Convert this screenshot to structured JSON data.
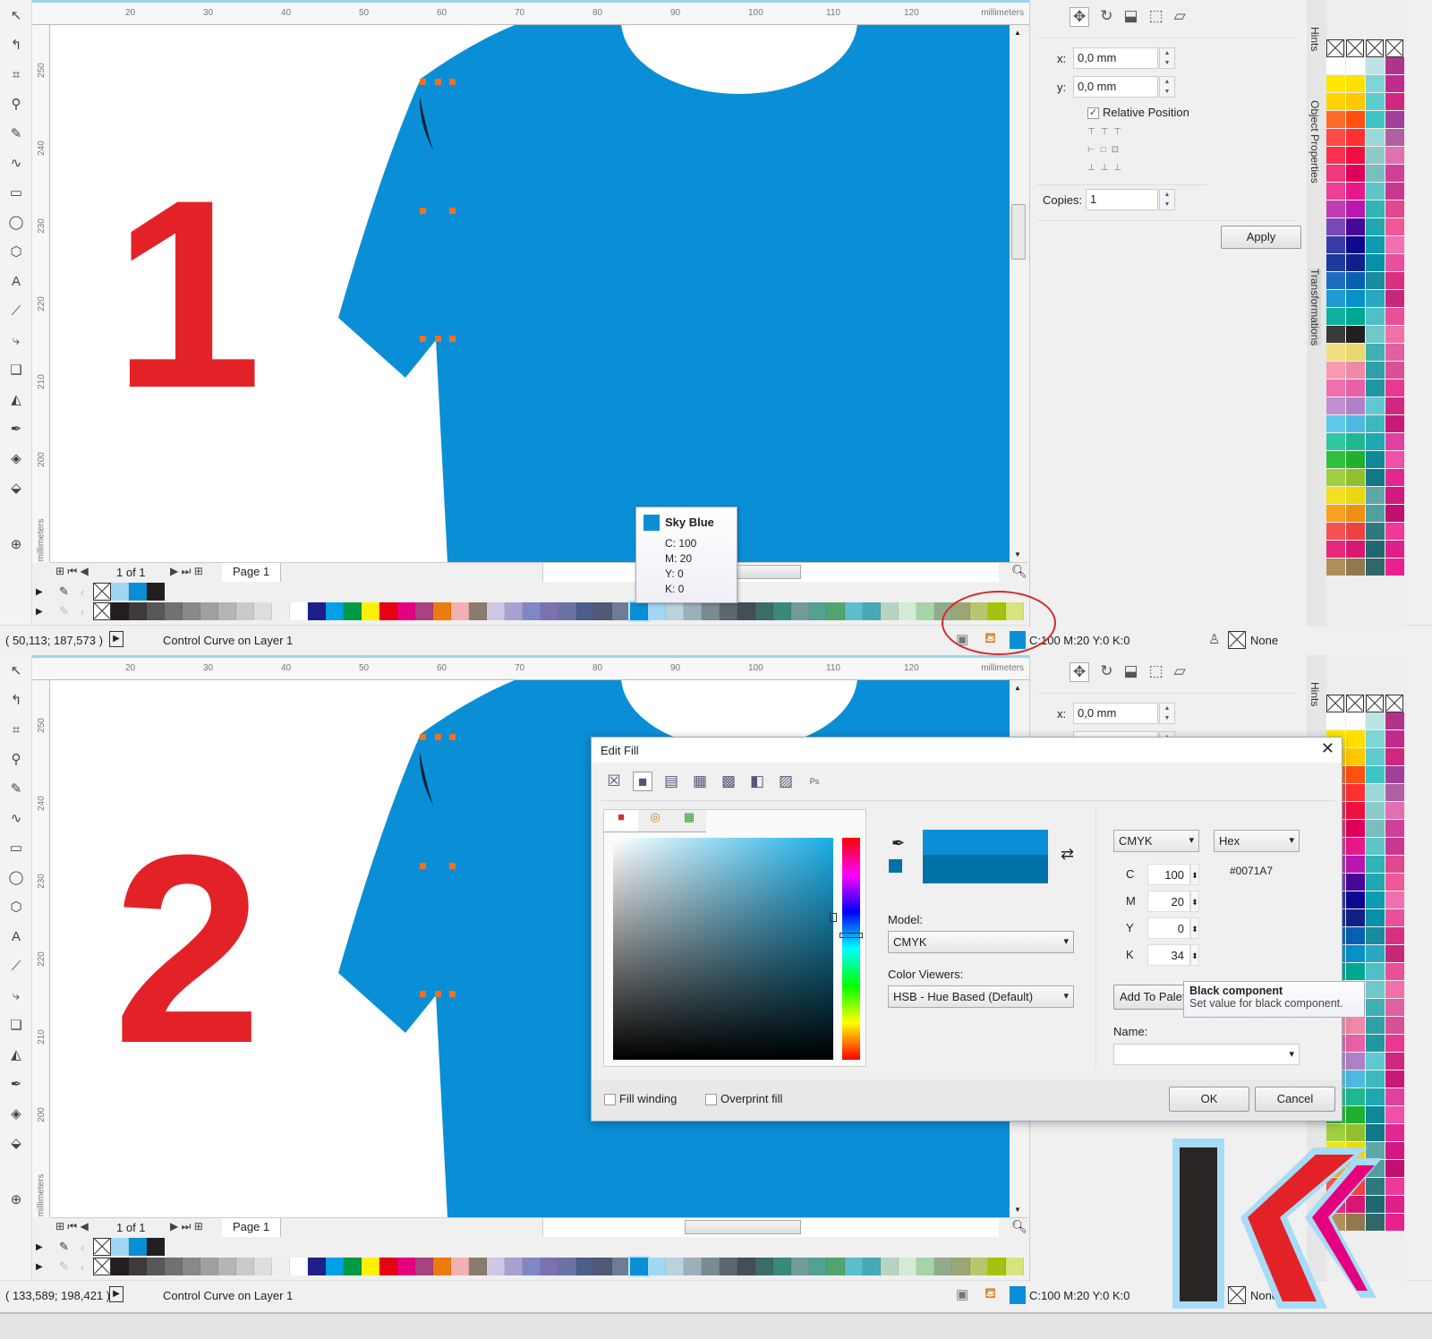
{
  "colors": {
    "shirt": "#0a8fd6",
    "number": "#e32228",
    "fill_new": "#0a8fd6",
    "fill_old": "#0071a7",
    "circle": "#d42a2a"
  },
  "ruler": {
    "unit": "millimeters",
    "top_ticks": [
      "20",
      "30",
      "40",
      "50",
      "60",
      "70",
      "80",
      "90",
      "100",
      "110",
      "120"
    ],
    "left_ticks": [
      "250",
      "240",
      "230",
      "220",
      "210",
      "200"
    ],
    "left_unit": "millimeters"
  },
  "toolbox_icons": [
    "pick-tool-icon",
    "shape-tool-icon",
    "crop-tool-icon",
    "zoom-tool-icon",
    "freehand-tool-icon",
    "artistic-media-icon",
    "rectangle-tool-icon",
    "ellipse-tool-icon",
    "polygon-tool-icon",
    "text-tool-icon",
    "parallel-dimension-icon",
    "connector-tool-icon",
    "drop-shadow-icon",
    "transparency-icon",
    "eyedropper-tool-icon",
    "interactive-fill-icon",
    "smart-fill-icon",
    "add-tool-icon"
  ],
  "panels": [
    {
      "step": "1",
      "page_nav": {
        "count": "1 of 1",
        "tab": "Page 1"
      },
      "status": {
        "coords": "( 50,113; 187,573 )",
        "object": "Control Curve on Layer 1",
        "fill": "C:100 M:20 Y:0 K:0",
        "outline": "None"
      }
    },
    {
      "step": "2",
      "page_nav": {
        "count": "1 of 1",
        "tab": "Page 1"
      },
      "status": {
        "coords": "( 133,589; 198,421 )",
        "object": "Control Curve on Layer 1",
        "fill": "C:100 M:20 Y:0 K:0",
        "outline": "None"
      }
    }
  ],
  "docker": {
    "x_label": "x:",
    "x_value": "0,0 mm",
    "y_label": "y:",
    "y_value": "0,0 mm",
    "relative_position": "Relative Position",
    "relative_checked": true,
    "copies_label": "Copies:",
    "copies_value": "1",
    "apply": "Apply",
    "tabs": [
      "Hints",
      "Object Properties",
      "Transformations"
    ]
  },
  "document_palette": [
    "#9fd7f3",
    "#0a8fd6",
    "#231f20"
  ],
  "default_palette": [
    "#231f20",
    "#3e3a39",
    "#595757",
    "#727171",
    "#898989",
    "#9fa0a0",
    "#b5b5b6",
    "#c9caca",
    "#dcdddd",
    "#efefef",
    "#ffffff",
    "#1d2088",
    "#00a0e9",
    "#009944",
    "#fff100",
    "#e60012",
    "#e4007f",
    "#a6437f",
    "#ed7b0b",
    "#f3b0b2",
    "#8b7b6e",
    "#cdc8e3",
    "#a9a1cf",
    "#7e88c6",
    "#7d6fb0",
    "#6b73a5",
    "#4c5d8a",
    "#535874",
    "#6d7d96",
    "#0a8fd6",
    "#a0d8f6",
    "#b9d2db",
    "#9cb0b9",
    "#7a8b93",
    "#5c686e",
    "#434f55",
    "#3a6d66",
    "#3b8a78",
    "#729c97",
    "#51a38f",
    "#53a46e",
    "#5cbecc",
    "#46a9b6",
    "#b8d3c2",
    "#d4ead6",
    "#a5d5a7",
    "#91ab8d",
    "#99a776",
    "#bac66d",
    "#a5c400",
    "#d8e37e"
  ],
  "tooltip": {
    "name": "Sky Blue",
    "c": "C: 100",
    "m": "M: 20",
    "y": "Y: 0",
    "k": "K: 0"
  },
  "edit_fill": {
    "title": "Edit Fill",
    "close": "✕",
    "fill_types": [
      "no-fill",
      "uniform-fill",
      "fountain-fill",
      "vector-pattern-fill",
      "bitmap-pattern-fill",
      "two-color-pattern-fill",
      "texture-fill",
      "postscript-fill"
    ],
    "model_label": "Model:",
    "model": "CMYK",
    "viewers_label": "Color Viewers:",
    "viewer": "HSB - Hue Based (Default)",
    "mode": "CMYK",
    "hex_mode": "Hex",
    "hex": "#0071A7",
    "c_label": "C",
    "c": "100",
    "m_label": "M",
    "m": "20",
    "y_label": "Y",
    "y": "0",
    "k_label": "K",
    "k": "34",
    "add_to_palette": "Add To Palette",
    "name_label": "Name:",
    "name": "",
    "fill_winding": "Fill winding",
    "overprint_fill": "Overprint fill",
    "ok": "OK",
    "cancel": "Cancel",
    "hint_title": "Black component",
    "hint_text": "Set value for black component."
  }
}
